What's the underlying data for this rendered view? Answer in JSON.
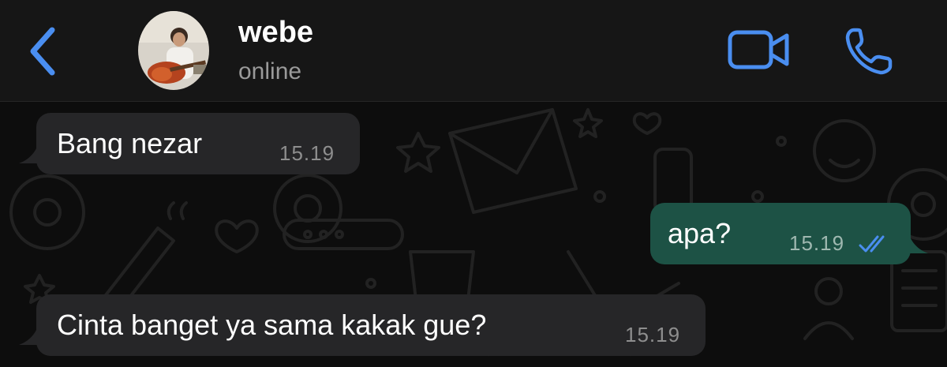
{
  "header": {
    "contact_name": "webe",
    "status": "online",
    "icons": {
      "back": "chevron-left-icon",
      "video": "video-camera-icon",
      "call": "phone-icon"
    },
    "accent_color": "#4a8ef0"
  },
  "messages": [
    {
      "direction": "incoming",
      "text": "Bang nezar",
      "time": "15.19"
    },
    {
      "direction": "outgoing",
      "text": "apa?",
      "time": "15.19",
      "status": "read"
    },
    {
      "direction": "incoming",
      "text": "Cinta banget ya sama kakak gue?",
      "time": "15.19"
    }
  ],
  "colors": {
    "incoming_bubble": "#262628",
    "outgoing_bubble": "#1d5245",
    "read_ticks": "#4a8ef0"
  }
}
